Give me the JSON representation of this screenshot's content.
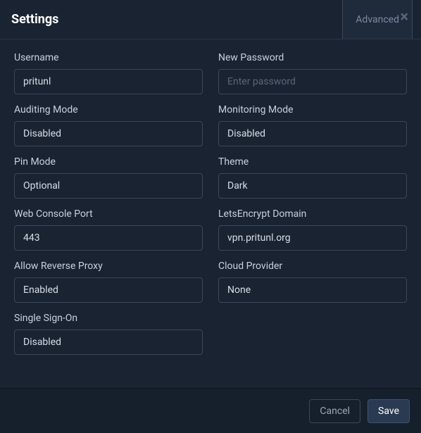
{
  "header": {
    "title": "Settings",
    "advanced_tab": "Advanced"
  },
  "left": {
    "username_label": "Username",
    "username_value": "pritunl",
    "auditing_label": "Auditing Mode",
    "auditing_value": "Disabled",
    "pin_label": "Pin Mode",
    "pin_value": "Optional",
    "port_label": "Web Console Port",
    "port_value": "443",
    "proxy_label": "Allow Reverse Proxy",
    "proxy_value": "Enabled",
    "sso_label": "Single Sign-On",
    "sso_value": "Disabled"
  },
  "right": {
    "password_label": "New Password",
    "password_placeholder": "Enter password",
    "monitoring_label": "Monitoring Mode",
    "monitoring_value": "Disabled",
    "theme_label": "Theme",
    "theme_value": "Dark",
    "letsencrypt_label": "LetsEncrypt Domain",
    "letsencrypt_value": "vpn.pritunl.org",
    "cloud_label": "Cloud Provider",
    "cloud_value": "None"
  },
  "footer": {
    "cancel": "Cancel",
    "save": "Save"
  }
}
